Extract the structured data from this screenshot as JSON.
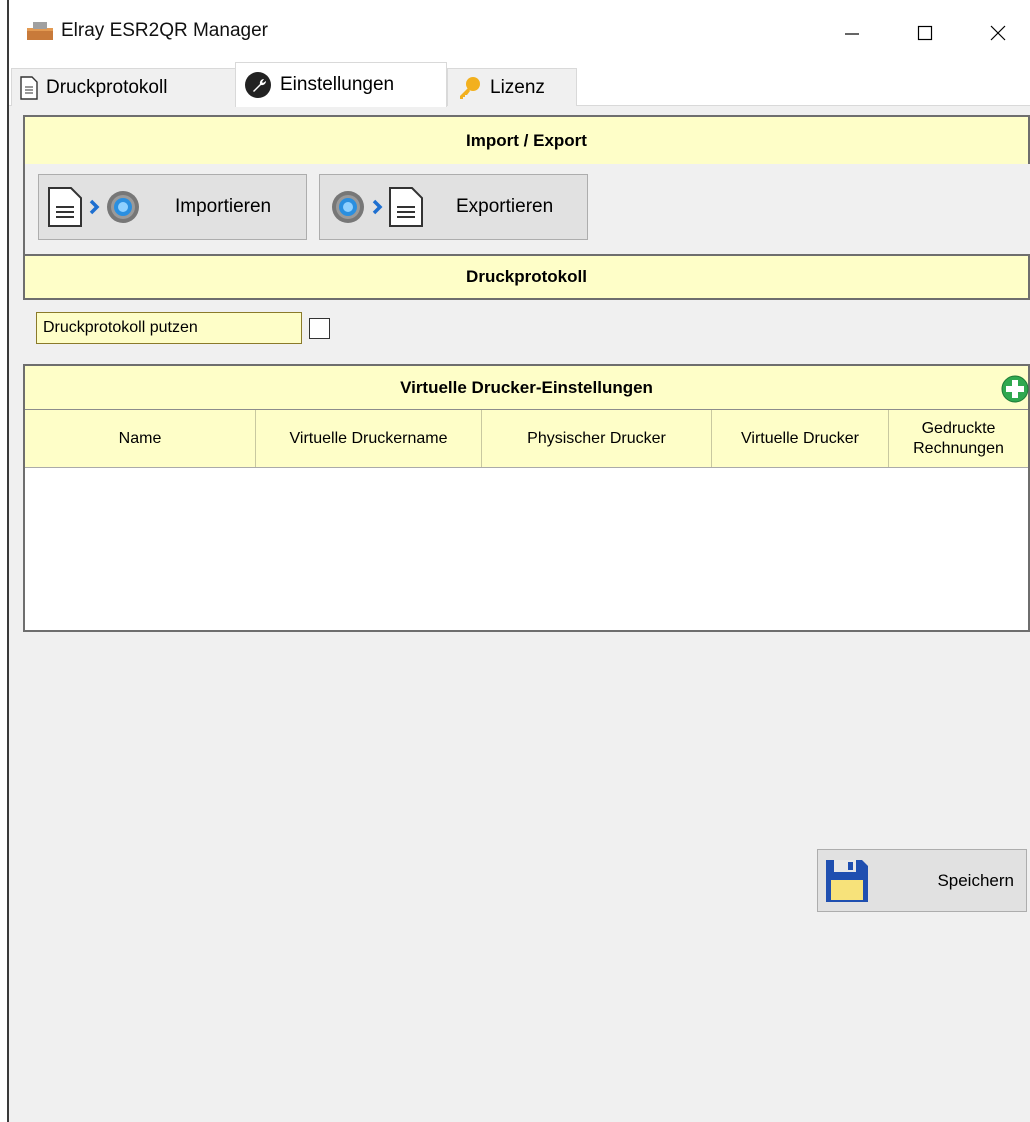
{
  "window": {
    "title": "Elray ESR2QR Manager",
    "min_glyph": "—",
    "max_glyph": "☐",
    "close_glyph": "✕"
  },
  "tabs": [
    {
      "label": "Druckprotokoll",
      "icon": "document-icon"
    },
    {
      "label": "Einstellungen",
      "icon": "wrench-icon"
    },
    {
      "label": "Lizenz",
      "icon": "key-icon"
    }
  ],
  "import_export": {
    "header": "Import / Export",
    "import_label": "Importieren",
    "export_label": "Exportieren"
  },
  "druckprotokoll": {
    "header": "Druckprotokoll",
    "clear_label": "Druckprotokoll putzen",
    "clear_checked": false
  },
  "printers": {
    "header": "Virtuelle Drucker-Einstellungen",
    "columns": [
      "Name",
      "Virtuelle Druckername",
      "Physischer Drucker",
      "Virtuelle Drucker",
      "Gedruckte Rechnungen"
    ],
    "rows": []
  },
  "save_label": "Speichern",
  "colors": {
    "header_bg": "#fefec8",
    "panel_bg": "#f0f0f0",
    "button_bg": "#e1e1e1",
    "accent_blue": "#1e6fd0",
    "add_green": "#2fa84f",
    "key_gold": "#f2b01e"
  }
}
